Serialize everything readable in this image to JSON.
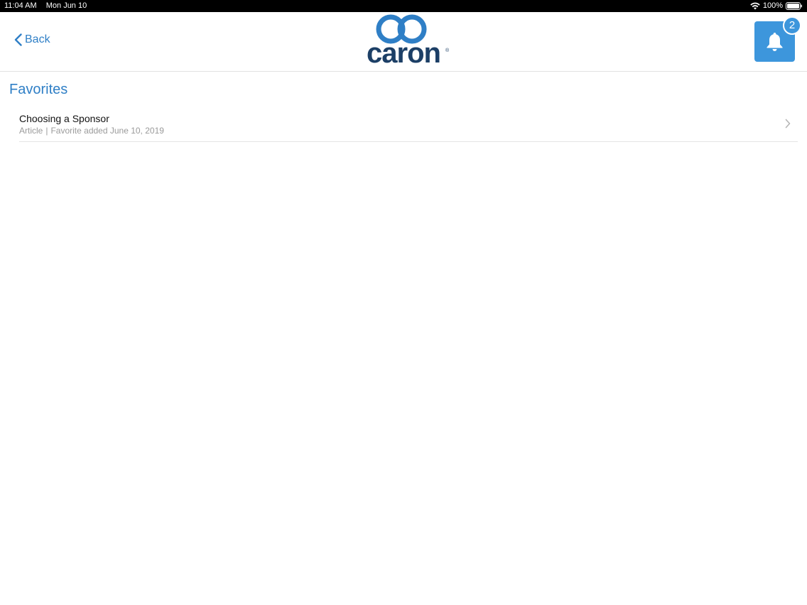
{
  "status_bar": {
    "time": "11:04 AM",
    "date": "Mon Jun 10",
    "battery": "100%"
  },
  "nav": {
    "back_label": "Back",
    "logo_text": "caron",
    "logo_mark": "®",
    "notification_count": "2"
  },
  "page": {
    "title": "Favorites"
  },
  "favorites": [
    {
      "title": "Choosing a Sponsor",
      "type": "Article",
      "separator": "|",
      "added": "Favorite added June 10, 2019"
    }
  ],
  "colors": {
    "accent": "#2f7fc6",
    "bell_bg": "#3d96dc",
    "logo_dark": "#1c3f66",
    "logo_ring": "#2f7fc6"
  }
}
